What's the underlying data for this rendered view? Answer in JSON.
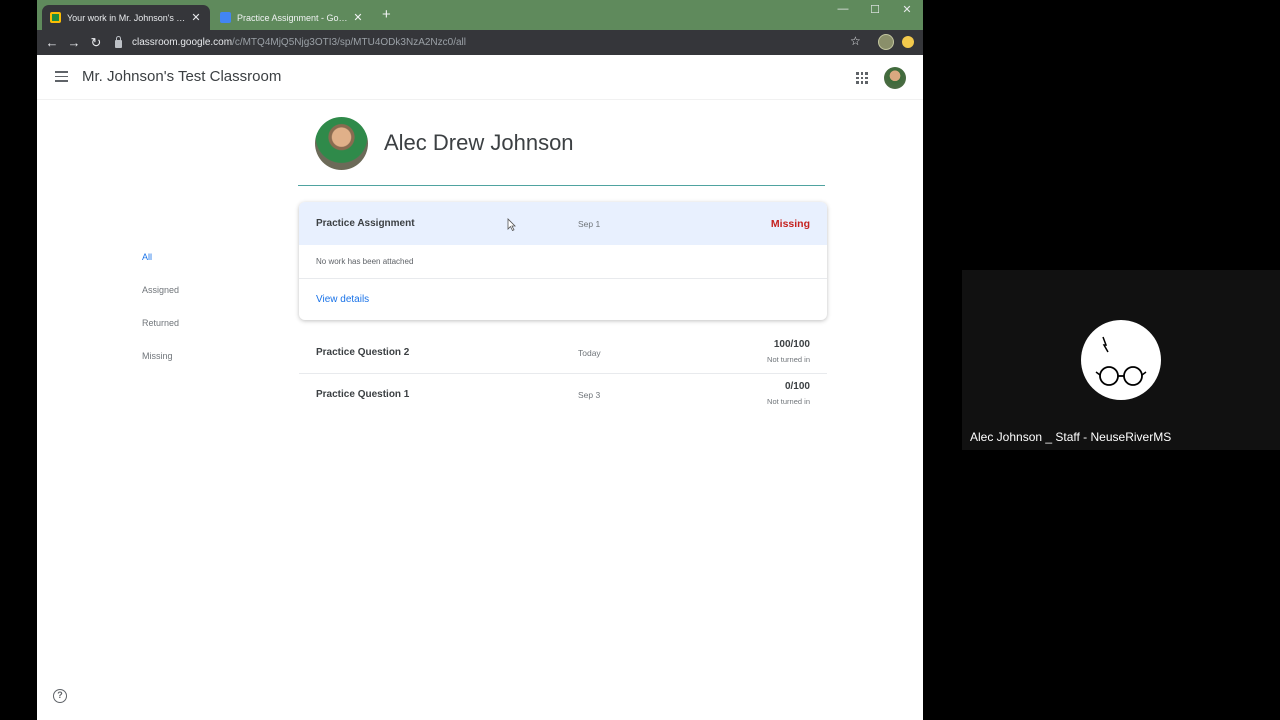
{
  "browser": {
    "tabs": [
      {
        "title": "Your work in Mr. Johnson's Test Cl",
        "active": true,
        "icon": "classroom-icon"
      },
      {
        "title": "Practice Assignment - Google Do",
        "active": false,
        "icon": "docs-icon"
      }
    ],
    "new_tab_label": "+",
    "url_host": "classroom.google.com",
    "url_path": "/c/MTQ4MjQ5Njg3OTI3/sp/MTU4ODk3NzA2Nzc0/all",
    "window_controls": {
      "minimize": "—",
      "maximize": "☐",
      "close": "✕"
    }
  },
  "classroom": {
    "class_name": "Mr. Johnson's Test Classroom",
    "student_name": "Alec Drew Johnson",
    "filters": [
      "All",
      "Assigned",
      "Returned",
      "Missing"
    ],
    "active_filter": "All",
    "expanded_item": {
      "title": "Practice Assignment",
      "date": "Sep 1",
      "status": "Missing",
      "attachment_note": "No work has been attached",
      "link_label": "View details"
    },
    "items": [
      {
        "title": "Practice Question 2",
        "date": "Today",
        "score": "100/100",
        "status": "Not turned in"
      },
      {
        "title": "Practice Question 1",
        "date": "Sep 3",
        "score": "0/100",
        "status": "Not turned in"
      }
    ],
    "help_label": "?"
  },
  "meet": {
    "participant_name": "Alec Johnson _ Staff - NeuseRiverMS"
  },
  "colors": {
    "tab_strip": "#5f8a5c",
    "toolbar": "#35363a",
    "link_blue": "#1a73e8",
    "missing_red": "#c5221f",
    "highlight": "#e8f0fe"
  }
}
